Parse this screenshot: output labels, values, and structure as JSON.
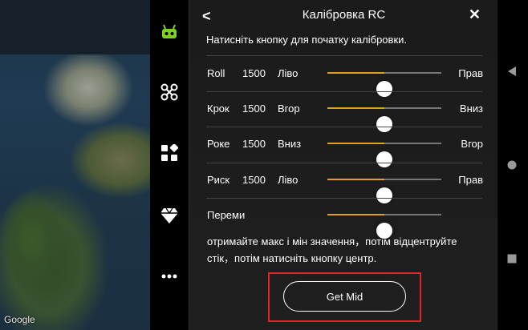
{
  "map": {
    "attribution": "Google"
  },
  "toolbar": {
    "items": [
      {
        "icon": "remote-controller-icon",
        "color": "#7ed321"
      },
      {
        "icon": "drone-icon"
      },
      {
        "icon": "grid-apps-icon"
      },
      {
        "icon": "diamond-icon"
      },
      {
        "icon": "more-icon"
      }
    ]
  },
  "panel": {
    "title": "Калібровка RC",
    "back_label": "<",
    "close_label": "✕",
    "instruction": "Натисніть кнопку для початку калібровки.",
    "channels": [
      {
        "name": "Roll",
        "value": "1500",
        "left_label": "Ліво",
        "right_label": "Прав",
        "level": 0.5
      },
      {
        "name": "Крок",
        "value": "1500",
        "left_label": "Вгор",
        "right_label": "Вниз",
        "level": 0.5
      },
      {
        "name": "Роке",
        "value": "1500",
        "left_label": "Вниз",
        "right_label": "Вгор",
        "level": 0.5
      },
      {
        "name": "Риск",
        "value": "1500",
        "left_label": "Ліво",
        "right_label": "Прав",
        "level": 0.5
      },
      {
        "name": "Переми",
        "value": "",
        "left_label": "",
        "right_label": "",
        "level": 0.5
      }
    ],
    "note": "отримайте макс і мін значення，потім відцентруйте стік，потім натисніть кнопку центр.",
    "get_mid_label": "Get Mid",
    "accent_color": "#e0a020",
    "highlight_color": "#e2232a"
  },
  "android_nav": {
    "back": "back-triangle-icon",
    "home": "home-circle-icon",
    "recents": "recents-square-icon"
  }
}
